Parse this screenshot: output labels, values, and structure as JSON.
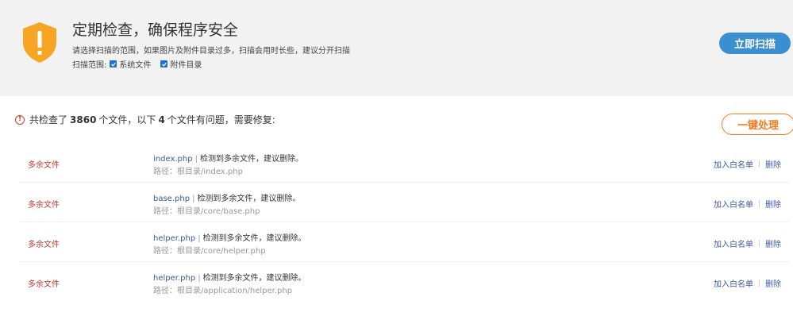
{
  "header": {
    "title": "定期检查，确保程序安全",
    "description": "请选择扫描的范围，如果图片及附件目录过多，扫描会用时长些，建议分开扫描",
    "scope_label": "扫描范围:",
    "scope_options": [
      {
        "label": "系统文件",
        "checked": true
      },
      {
        "label": "附件目录",
        "checked": true
      }
    ],
    "scan_button": "立即扫描",
    "shield_color": "#f7a623"
  },
  "summary": {
    "prefix": "共检查了",
    "total": "3860",
    "middle": "个文件，以下",
    "issues": "4",
    "suffix": "个文件有问题，需要修复:",
    "fix_button": "一键处理"
  },
  "rows": [
    {
      "type": "多余文件",
      "file": "index.php",
      "message": "检测到多余文件，建议删除。",
      "path": "路径：根目录/index.php",
      "whitelist": "加入白名单",
      "delete": "删除"
    },
    {
      "type": "多余文件",
      "file": "base.php",
      "message": "检测到多余文件，建议删除。",
      "path": "路径：根目录/core/base.php",
      "whitelist": "加入白名单",
      "delete": "删除"
    },
    {
      "type": "多余文件",
      "file": "helper.php",
      "message": "检测到多余文件，建议删除。",
      "path": "路径：根目录/core/helper.php",
      "whitelist": "加入白名单",
      "delete": "删除"
    },
    {
      "type": "多余文件",
      "file": "helper.php",
      "message": "检测到多余文件，建议删除。",
      "path": "路径：根目录/application/helper.php",
      "whitelist": "加入白名单",
      "delete": "删除"
    }
  ],
  "colors": {
    "accent_blue": "#3a8fd0",
    "accent_orange": "#f27b22",
    "error_red": "#c0392b",
    "link_blue": "#3d5a99"
  }
}
